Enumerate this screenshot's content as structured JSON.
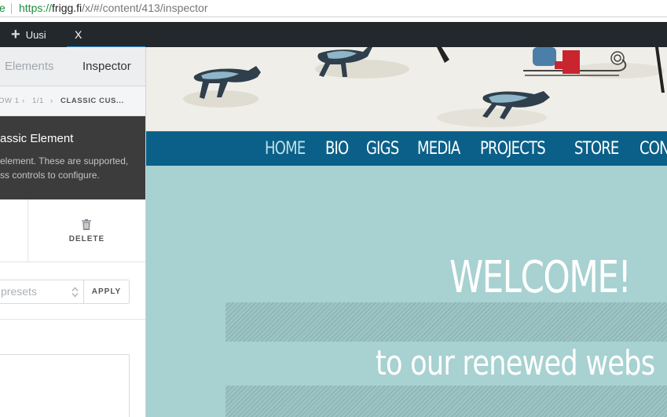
{
  "browser": {
    "security_fragment": "e",
    "url_protocol": "https://",
    "url_host": "frigg.fi",
    "url_path": "/x/#/content/413/inspector"
  },
  "admin_bar": {
    "new_label": "Uusi",
    "close_label": "X",
    "accent_color": "#2d8ccd"
  },
  "inspector": {
    "tabs": [
      {
        "label": "Elements",
        "active": false
      },
      {
        "label": "Inspector",
        "active": true
      }
    ],
    "breadcrumb": {
      "row": "OW 1",
      "column": "1/1",
      "element": "CLASSIC CUS..."
    },
    "element_title": "assic Element",
    "element_description": "element. These are supported,\nss controls to configure.",
    "delete_label": "DELETE",
    "presets_placeholder": "presets",
    "apply_label": "APPLY"
  },
  "website": {
    "nav_items": [
      "HOME",
      "BIO",
      "GIGS",
      "MEDIA",
      "PROJECTS",
      "STORE",
      "CON"
    ],
    "active_nav": "HOME",
    "welcome_text": "WELCOME!",
    "subtitle_text": "to our renewed webs",
    "colors": {
      "nav_bg": "#0a6089",
      "content_bg": "#a8d1d1",
      "hero_bg": "#f0eee8"
    }
  }
}
